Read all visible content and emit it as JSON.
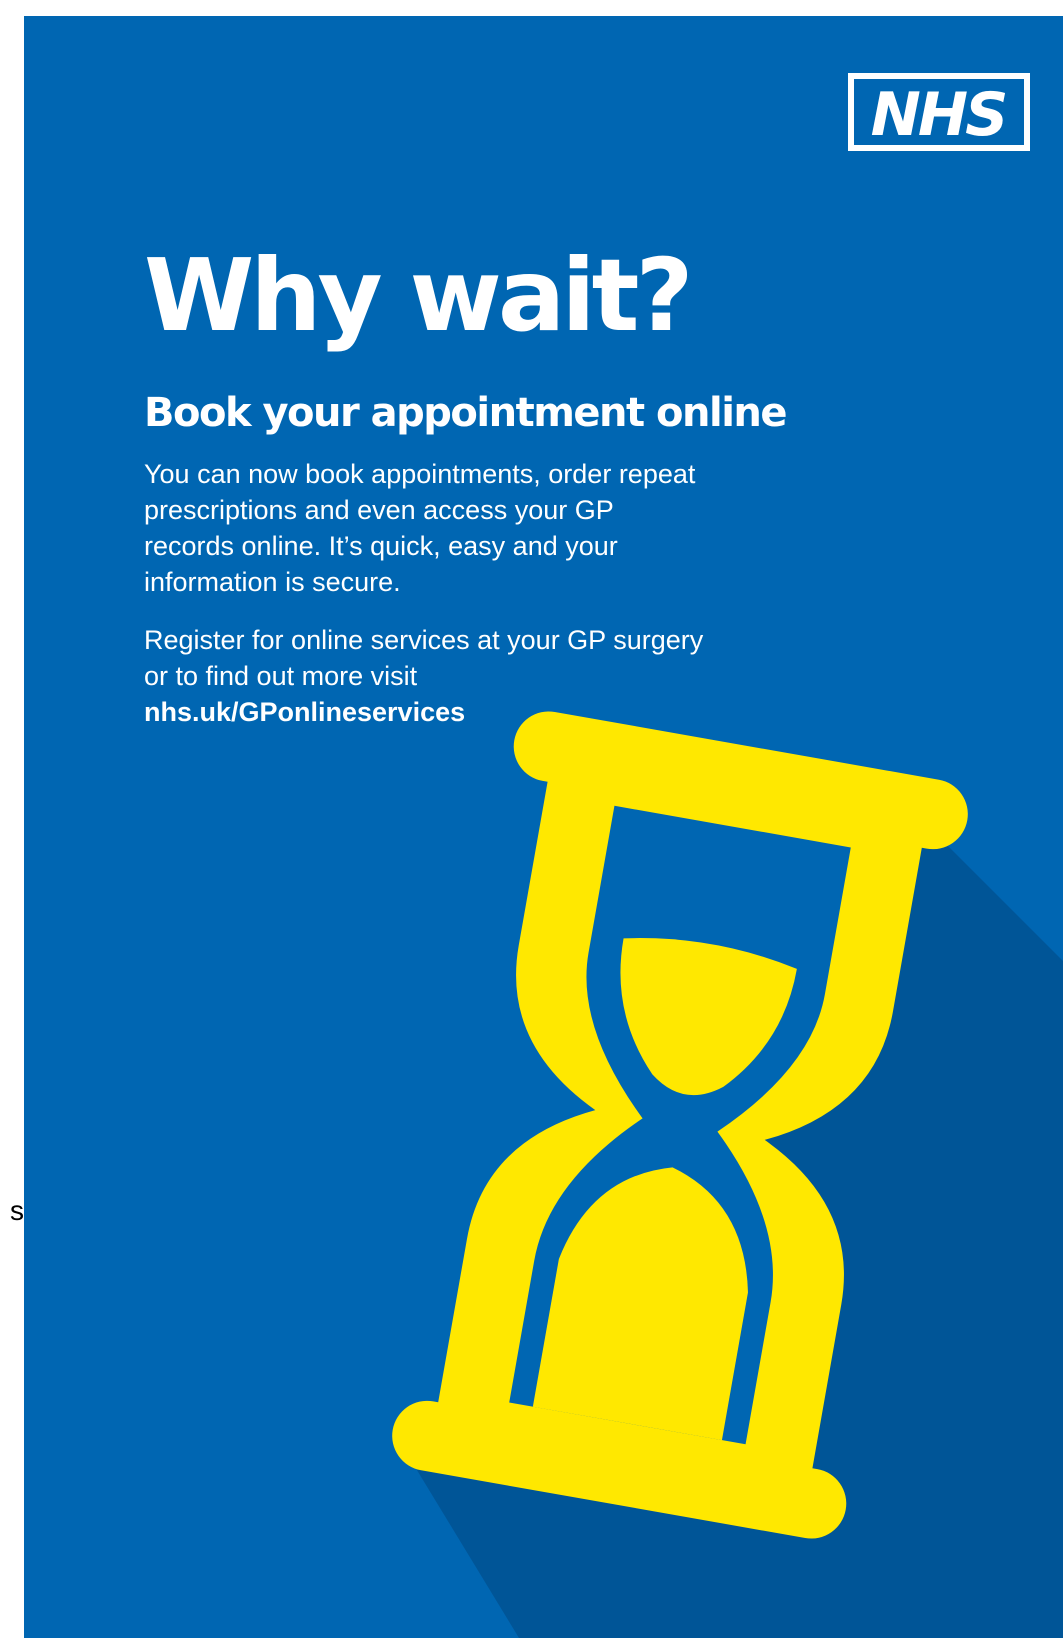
{
  "brand": {
    "logo_text": "NHS",
    "colors": {
      "background_blue": "#0066b2",
      "shadow_blue": "#005597",
      "hourglass_yellow": "#ffe800",
      "text": "#ffffff"
    }
  },
  "poster": {
    "headline": "Why wait?",
    "subheading": "Book your appointment online",
    "body_1": "You can now book appointments, order repeat prescriptions and even access your GP records online. It’s quick, easy and your information is secure.",
    "body_2": "Register for online services at your GP surgery or to find out more visit",
    "link": "nhs.uk/GPonlineservices",
    "illustration_icon": "hourglass-icon"
  },
  "margin_fragment": "s"
}
